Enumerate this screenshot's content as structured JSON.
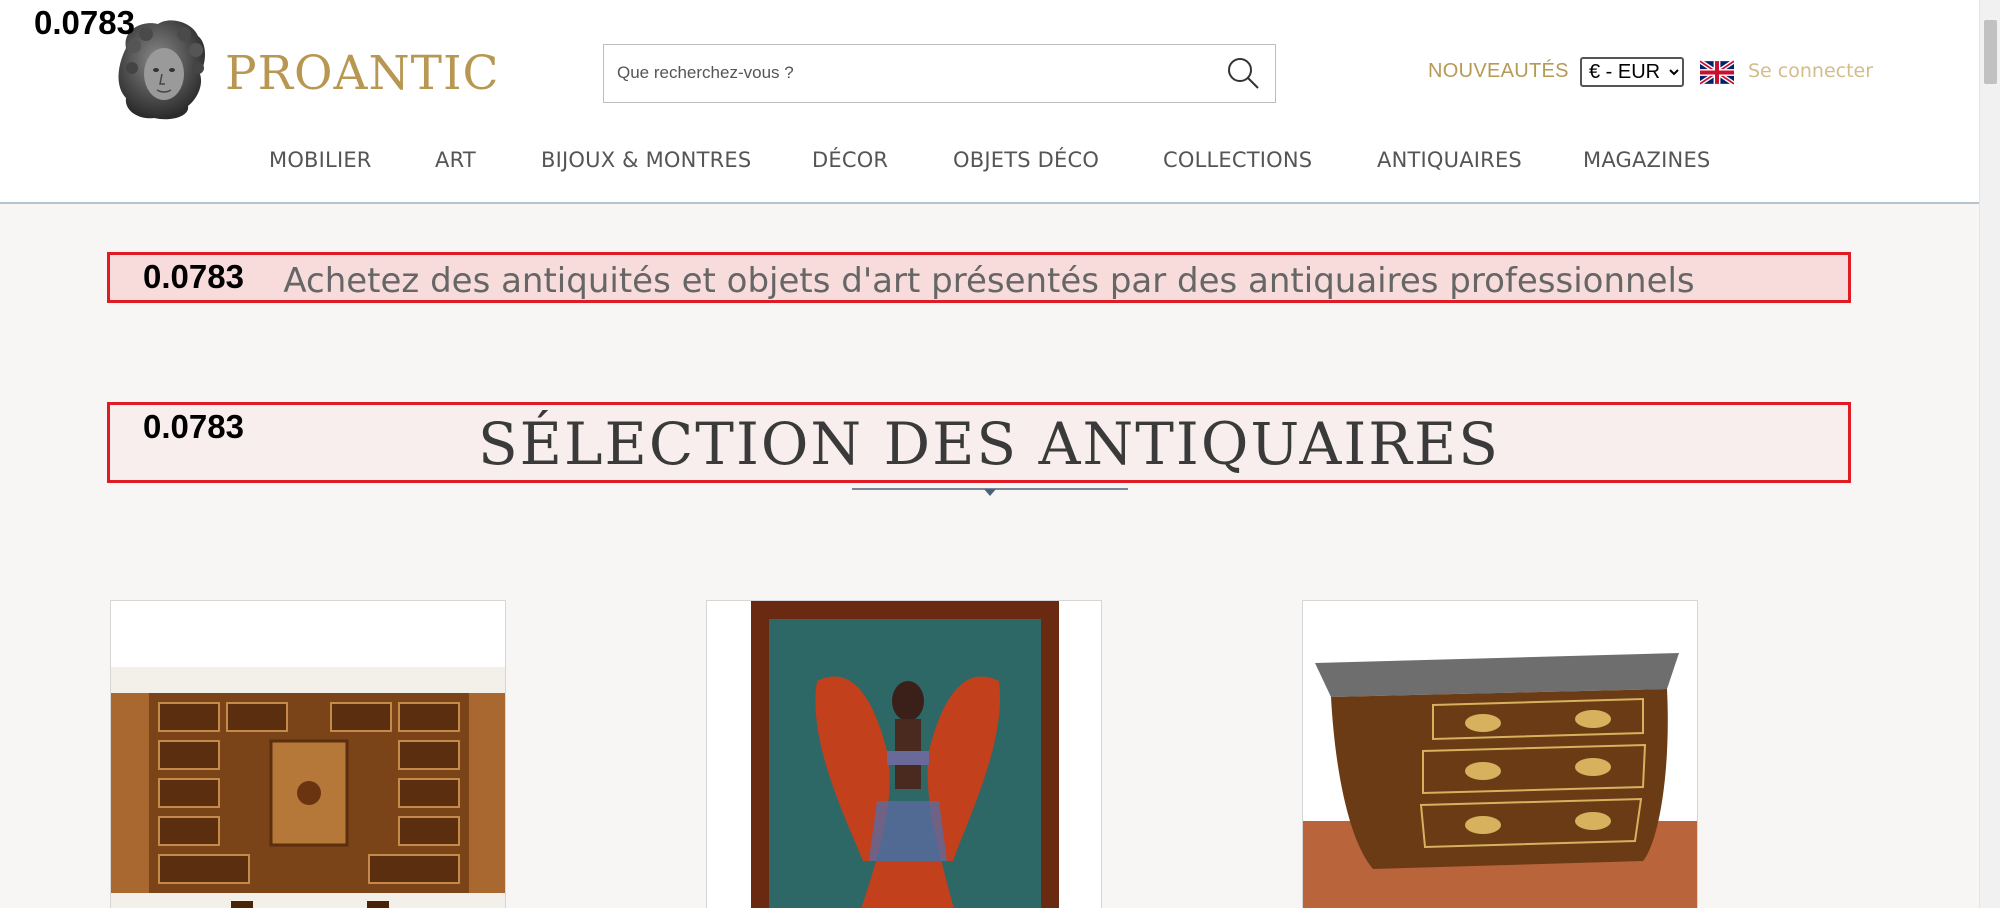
{
  "overlay": {
    "label": "0.0783"
  },
  "header": {
    "logo_text": "PROANTIC",
    "search_placeholder": "Que recherchez-vous ?",
    "nouveautes": "NOUVEAUTÉS",
    "currency_selected": "€ - EUR",
    "language_flag": "uk-flag-icon",
    "login": "Se connecter",
    "colors": {
      "gold": "#b89752",
      "login": "#d4bc8a"
    }
  },
  "nav": {
    "items": [
      {
        "label": "MOBILIER"
      },
      {
        "label": "ART"
      },
      {
        "label": "BIJOUX & MONTRES"
      },
      {
        "label": "DÉCOR"
      },
      {
        "label": "OBJETS DÉCO"
      },
      {
        "label": "COLLECTIONS"
      },
      {
        "label": "ANTIQUAIRES"
      },
      {
        "label": "MAGAZINES"
      }
    ]
  },
  "main": {
    "tagline": "Achetez des antiquités et objets d'art présentés par des antiquaires professionnels",
    "section_title": "SÉLECTION DES ANTIQUAIRES",
    "products": [
      {
        "image": "antique-cabinet-image"
      },
      {
        "image": "dancer-painting-image"
      },
      {
        "image": "marble-top-commode-image"
      }
    ]
  },
  "colors": {
    "highlight_border": "#e01b24",
    "page_bg": "#f7f6f4"
  }
}
